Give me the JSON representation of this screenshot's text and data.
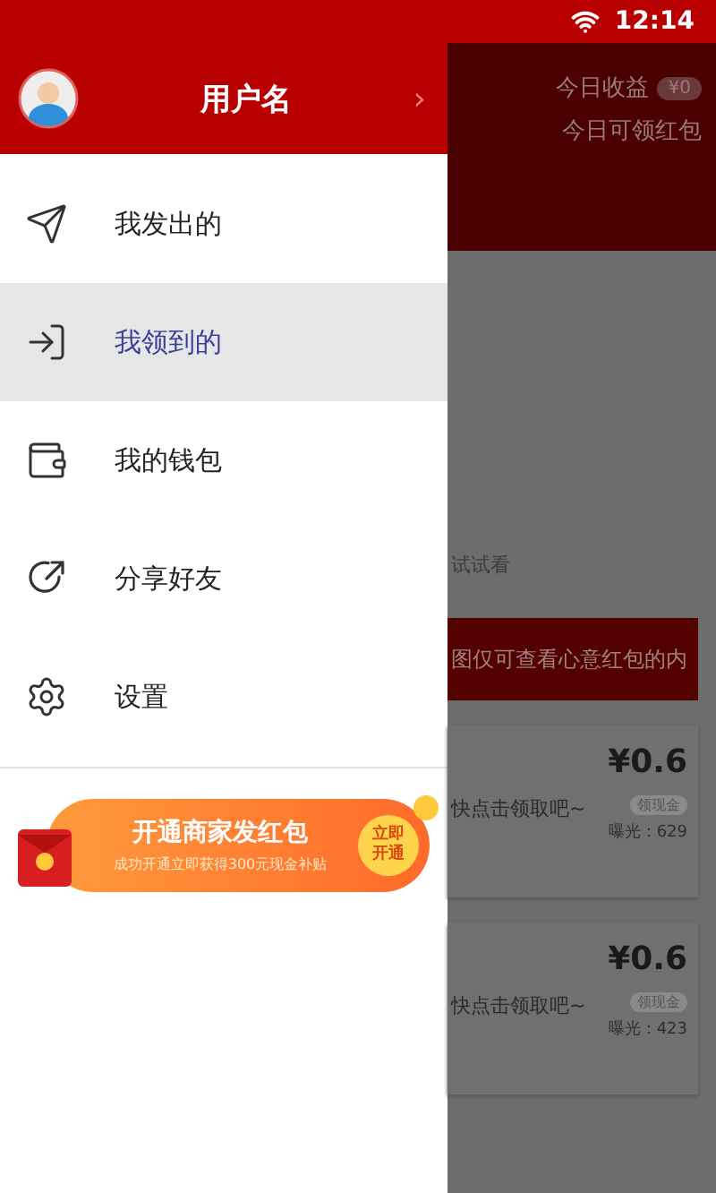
{
  "status_bar": {
    "time": "12:14"
  },
  "drawer": {
    "header": {
      "username": "用户名",
      "chevron": "›"
    },
    "menu": [
      {
        "kind": "send",
        "label": "我发出的",
        "selected": false
      },
      {
        "kind": "enter",
        "label": "我领到的",
        "selected": true
      },
      {
        "kind": "wallet",
        "label": "我的钱包",
        "selected": false
      },
      {
        "kind": "share",
        "label": "分享好友",
        "selected": false
      },
      {
        "kind": "settings",
        "label": "设置",
        "selected": false
      }
    ],
    "promo": {
      "title": "开通商家发红包",
      "subtitle": "成功开通立即获得300元现金补贴",
      "action": "立即开通"
    }
  },
  "background": {
    "stats": [
      {
        "label": "今日收益",
        "value": "¥0"
      },
      {
        "label": "今日可领红包"
      }
    ],
    "hint": "试试看",
    "notice": "图仅可查看心意红包的内",
    "cards": [
      {
        "text": "快点击领取吧~",
        "amount": "¥0.6",
        "tag": "领现金",
        "views": "曝光：629"
      },
      {
        "text": "快点击领取吧~",
        "amount": "¥0.6",
        "tag": "领现金",
        "views": "曝光：423"
      }
    ]
  }
}
